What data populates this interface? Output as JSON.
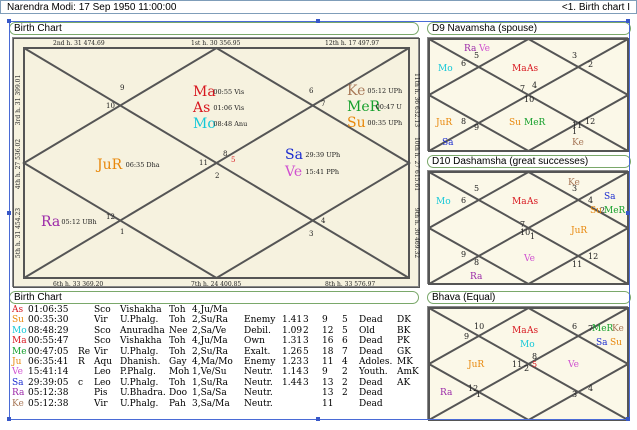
{
  "header": {
    "left": "Narendra Modi:   17 Sep 1950  11:00:00",
    "right": "<1. Birth chart I"
  },
  "panels": {
    "birth_chart_title": "Birth Chart",
    "d9_title": "D9 Navamsha  (spouse)",
    "d10_title": "D10 Dashamsha  (great successes)",
    "table_title": "Birth Chart",
    "bhava_title": "Bhava (Equal)"
  },
  "birth_chart": {
    "house_labels": {
      "top_left": "2nd h.  31  474.69",
      "top_mid": "1st h.  30  356.95",
      "top_right": "12th h.  17  497.97",
      "left_top": "3rd h.  31  399.01",
      "left_mid": "4th h.  27  536.02",
      "left_bot": "5th h.  31  454.23",
      "right_top": "11th h.  36  632.13",
      "right_mid": "10th h.  27  615.61",
      "right_bot": "9th h.  30  469.32",
      "bot_left": "6th h.  33  369.20",
      "bot_mid": "7th h.  24  400.85",
      "bot_right": "8th h.  33  576.97"
    },
    "signs": [
      "9",
      "10",
      "6",
      "7",
      "8",
      "11",
      "5",
      "2",
      "12",
      "1",
      "3",
      "4"
    ],
    "planets": [
      {
        "name": "Ma",
        "info": "00:55 Vis",
        "color": "#d8171f"
      },
      {
        "name": "As",
        "info": "01:06 Vis",
        "color": "#d8171f"
      },
      {
        "name": "Mo",
        "info": "08:48 Anu",
        "color": "#16c8d8"
      },
      {
        "name": "Ke",
        "info": "05:12 UPh",
        "color": "#a87858"
      },
      {
        "name": "MeR",
        "info": "00:47 U",
        "color": "#15a02c"
      },
      {
        "name": "Su",
        "info": "00:35 UPh",
        "color": "#e8880c"
      },
      {
        "name": "JuR",
        "info": "06:35 Dha",
        "color": "#e8880c"
      },
      {
        "name": "Sa",
        "info": "29:39 UPh",
        "color": "#1a2bd0"
      },
      {
        "name": "Ve",
        "info": "15:41 PPh",
        "color": "#d050d0"
      },
      {
        "name": "Ra",
        "info": "05:12 UBh",
        "color": "#9b28a8"
      }
    ]
  },
  "d9": {
    "signs": [
      "6",
      "5",
      "3",
      "2",
      "7",
      "4",
      "10",
      "8",
      "9",
      "1",
      "12",
      "11"
    ],
    "planets": [
      {
        "name": "Ra",
        "color": "#9b28a8"
      },
      {
        "name": "Ve",
        "color": "#d050d0"
      },
      {
        "name": "Mo",
        "color": "#16c8d8"
      },
      {
        "name": "Ma",
        "color": "#d8171f"
      },
      {
        "name": "As",
        "color": "#d8171f"
      },
      {
        "name": "JuR",
        "color": "#e8880c"
      },
      {
        "name": "Su",
        "color": "#e8880c"
      },
      {
        "name": "MeR",
        "color": "#15a02c"
      },
      {
        "name": "Sa",
        "color": "#1a2bd0"
      },
      {
        "name": "Ke",
        "color": "#a87858"
      }
    ]
  },
  "d10": {
    "signs": [
      "6",
      "5",
      "3",
      "4",
      "10",
      "7",
      "1",
      "9",
      "8",
      "11",
      "12",
      "2"
    ],
    "planets": [
      {
        "name": "Ke",
        "color": "#a87858"
      },
      {
        "name": "Mo",
        "color": "#16c8d8"
      },
      {
        "name": "Ma",
        "color": "#d8171f"
      },
      {
        "name": "As",
        "color": "#d8171f"
      },
      {
        "name": "Sa",
        "color": "#1a2bd0"
      },
      {
        "name": "Su",
        "color": "#e8880c"
      },
      {
        "name": "MeR",
        "color": "#15a02c"
      },
      {
        "name": "JuR",
        "color": "#e8880c"
      },
      {
        "name": "Ve",
        "color": "#d050d0"
      },
      {
        "name": "Ra",
        "color": "#9b28a8"
      }
    ]
  },
  "bhava": {
    "signs": [
      "9",
      "6",
      "7",
      "10",
      "8",
      "11",
      "5",
      "2",
      "12",
      "1",
      "3",
      "4"
    ],
    "planets": [
      {
        "name": "Ma",
        "color": "#d8171f"
      },
      {
        "name": "As",
        "color": "#d8171f"
      },
      {
        "name": "Mo",
        "color": "#16c8d8"
      },
      {
        "name": "MeR",
        "color": "#15a02c"
      },
      {
        "name": "Ke",
        "color": "#a87858"
      },
      {
        "name": "Sa",
        "color": "#1a2bd0"
      },
      {
        "name": "Su",
        "color": "#e8880c"
      },
      {
        "name": "JuR",
        "color": "#e8880c"
      },
      {
        "name": "Ve",
        "color": "#d050d0"
      },
      {
        "name": "Ra",
        "color": "#9b28a8"
      }
    ]
  },
  "table": {
    "rows": [
      {
        "p": "As",
        "c": "#d8171f",
        "deg": "01:06:35",
        "r": "",
        "sign": "Sco",
        "nak": "Vishakha",
        "lord": "Toh",
        "pada": "4,Ju/Ma",
        "state": "",
        "v1": "",
        "v2": "",
        "h1": "",
        "h2": "",
        "status": "",
        "kar": ""
      },
      {
        "p": "Su",
        "c": "#e8880c",
        "deg": "00:35:30",
        "r": "",
        "sign": "Vir",
        "nak": "U.Phalg.",
        "lord": "Toh",
        "pada": "2,Su/Ra",
        "state": "Enemy",
        "v1": "1.41",
        "v2": "3",
        "h1": "9",
        "h2": "5",
        "status": "Dead",
        "kar": "DK"
      },
      {
        "p": "Mo",
        "c": "#16c8d8",
        "deg": "08:48:29",
        "r": "",
        "sign": "Sco",
        "nak": "Anuradha",
        "lord": "Nee",
        "pada": "2,Sa/Ve",
        "state": "Debil.",
        "v1": "1.09",
        "v2": "2",
        "h1": "12",
        "h2": "5",
        "status": "Old",
        "kar": "BK"
      },
      {
        "p": "Ma",
        "c": "#d8171f",
        "deg": "00:55:47",
        "r": "",
        "sign": "Sco",
        "nak": "Vishakha",
        "lord": "Toh",
        "pada": "4,Ju/Ma",
        "state": "Own",
        "v1": "1.31",
        "v2": "3",
        "h1": "16",
        "h2": "6",
        "status": "Dead",
        "kar": "PK"
      },
      {
        "p": "Me",
        "c": "#15a02c",
        "deg": "00:47:05",
        "r": "Re",
        "sign": "Vir",
        "nak": "U.Phalg.",
        "lord": "Toh",
        "pada": "2,Su/Ra",
        "state": "Exalt.",
        "v1": "1.26",
        "v2": "5",
        "h1": "18",
        "h2": "7",
        "status": "Dead",
        "kar": "GK"
      },
      {
        "p": "Ju",
        "c": "#e8880c",
        "deg": "06:35:41",
        "r": "R",
        "sign": "Aqu",
        "nak": "Dhanish.",
        "lord": "Gay",
        "pada": "4,Ma/Mo",
        "state": "Enemy",
        "v1": "1.23",
        "v2": "3",
        "h1": "11",
        "h2": "4",
        "status": "Adoles.",
        "kar": "MK"
      },
      {
        "p": "Ve",
        "c": "#d050d0",
        "deg": "15:41:14",
        "r": "",
        "sign": "Leo",
        "nak": "P.Phalg.",
        "lord": "Moh",
        "pada": "1,Ve/Su",
        "state": "Neutr.",
        "v1": "1.14",
        "v2": "3",
        "h1": "9",
        "h2": "2",
        "status": "Youth.",
        "kar": "AmK"
      },
      {
        "p": "Sa",
        "c": "#1a2bd0",
        "deg": "29:39:05",
        "r": "c",
        "sign": "Leo",
        "nak": "U.Phalg.",
        "lord": "Toh",
        "pada": "1,Su/Ra",
        "state": "Neutr.",
        "v1": "1.44",
        "v2": "3",
        "h1": "13",
        "h2": "2",
        "status": "Dead",
        "kar": "AK"
      },
      {
        "p": "Ra",
        "c": "#9b28a8",
        "deg": "05:12:38",
        "r": "",
        "sign": "Pis",
        "nak": "U.Bhadra.",
        "lord": "Doo",
        "pada": "1,Sa/Sa",
        "state": "Neutr.",
        "v1": "",
        "v2": "",
        "h1": "13",
        "h2": "2",
        "status": "Dead",
        "kar": ""
      },
      {
        "p": "Ke",
        "c": "#a87858",
        "deg": "05:12:38",
        "r": "",
        "sign": "Vir",
        "nak": "U.Phalg.",
        "lord": "Pah",
        "pada": "3,Sa/Ma",
        "state": "Neutr.",
        "v1": "",
        "v2": "",
        "h1": "11",
        "h2": "",
        "status": "Dead",
        "kar": ""
      }
    ]
  }
}
